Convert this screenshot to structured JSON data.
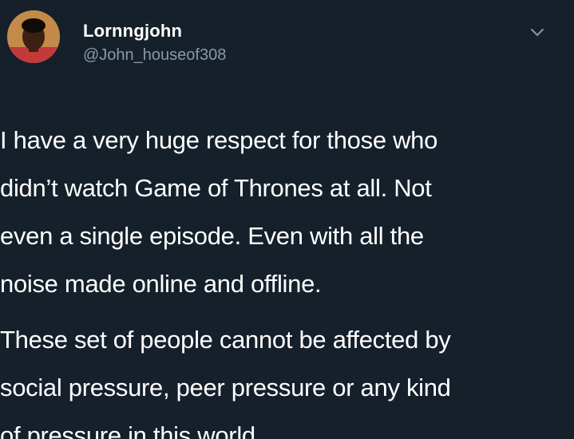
{
  "tweet": {
    "author": {
      "display_name": "Lornngjohn",
      "handle": "@John_houseof308"
    },
    "icons": {
      "avatar": "profile-photo",
      "menu": "chevron-down-icon"
    },
    "paragraphs": [
      "I have a very huge respect for those who\ndidn’t watch Game of Thrones at all. Not\neven a single episode. Even with all the\nnoise made online and offline.",
      "These set of people cannot be affected by\nsocial pressure, peer pressure or any kind\nof pressure in this world"
    ],
    "colors": {
      "background": "#15202b",
      "text": "#ffffff",
      "secondary_text": "#8899a6"
    }
  }
}
